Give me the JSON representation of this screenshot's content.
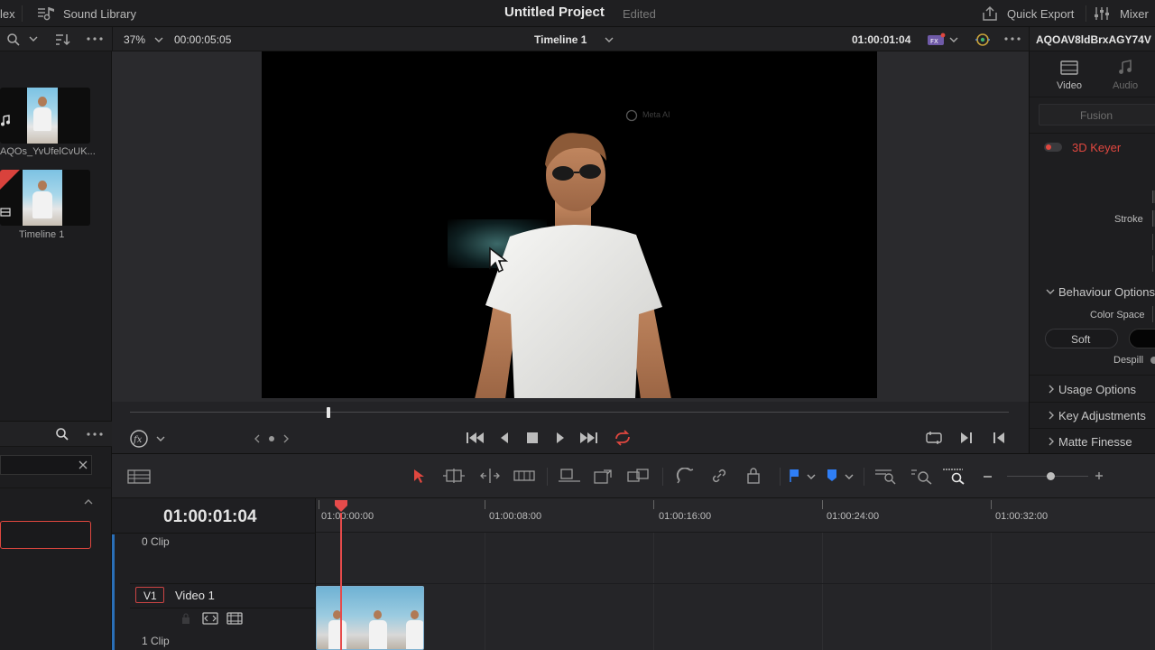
{
  "topbar": {
    "partial_left_label": "lex",
    "sound_library_label": "Sound Library",
    "project_title": "Untitled Project",
    "project_status": "Edited",
    "quick_export_label": "Quick Export",
    "mixer_label": "Mixer"
  },
  "viewer_bar": {
    "zoom": "37%",
    "source_timecode": "00:00:05:05",
    "timeline_name": "Timeline 1",
    "record_timecode": "01:00:01:04",
    "clip_name": "AQOAV8ldBrxAGY74V"
  },
  "media_pool": {
    "items": [
      {
        "label": "AQOs_YvUfelCvUK..."
      },
      {
        "label": "Timeline 1"
      }
    ]
  },
  "viewer": {
    "watermark": "Meta AI"
  },
  "inspector": {
    "tabs": [
      {
        "label": "Video",
        "icon": "video-icon",
        "active": true
      },
      {
        "label": "Audio",
        "icon": "music-note-icon",
        "active": false
      }
    ],
    "fusion_button": "Fusion",
    "effect_name": "3D Keyer",
    "stroke_label": "Stroke",
    "behaviour_options": "Behaviour Options",
    "color_space_label": "Color Space",
    "soft_button": "Soft",
    "despill_label": "Despill",
    "usage_options": "Usage Options",
    "key_adjustments": "Key Adjustments",
    "matte_finesse": "Matte Finesse"
  },
  "timeline": {
    "current_timecode": "01:00:01:04",
    "ruler_labels": [
      "01:00:00:00",
      "01:00:08:00",
      "01:00:16:00",
      "01:00:24:00",
      "01:00:32:00"
    ],
    "upper_track_clip_count": "0 Clip",
    "track_id": "V1",
    "track_name": "Video 1",
    "track_clip_count": "1 Clip"
  },
  "colors": {
    "accent_red": "#e0473f",
    "playhead": "#e64b4b",
    "flag_blue": "#2f7ef5"
  }
}
